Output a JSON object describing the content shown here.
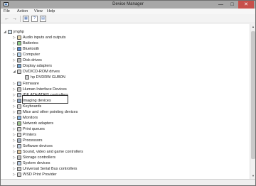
{
  "window": {
    "title": "Device Manager",
    "controls": [
      "—",
      "□",
      "✕"
    ]
  },
  "menu": [
    "File",
    "Action",
    "View",
    "Help"
  ],
  "toolbar": {
    "back": "←",
    "forward": "→",
    "properties": "▦",
    "help": "?",
    "view": "▤"
  },
  "tree": {
    "root": "jmghp",
    "items": [
      "Audio inputs and outputs",
      "Batteries",
      "Bluetooth",
      "Computer",
      "Disk drives",
      "Display adapters",
      "DVD/CD-ROM drives",
      "hp DVDRW GUB0N",
      "Firmware",
      "Human Interface Devices",
      "IDE ATA/ATAPI controllers",
      "Imaging devices",
      "Keyboards",
      "Mice and other pointing devices",
      "Monitors",
      "Network adapters",
      "Print queues",
      "Printers",
      "Processors",
      "Software devices",
      "Sound, video and game controllers",
      "Storage controllers",
      "System devices",
      "Universal Serial Bus controllers",
      "WSD Print Provider"
    ]
  },
  "status": ""
}
